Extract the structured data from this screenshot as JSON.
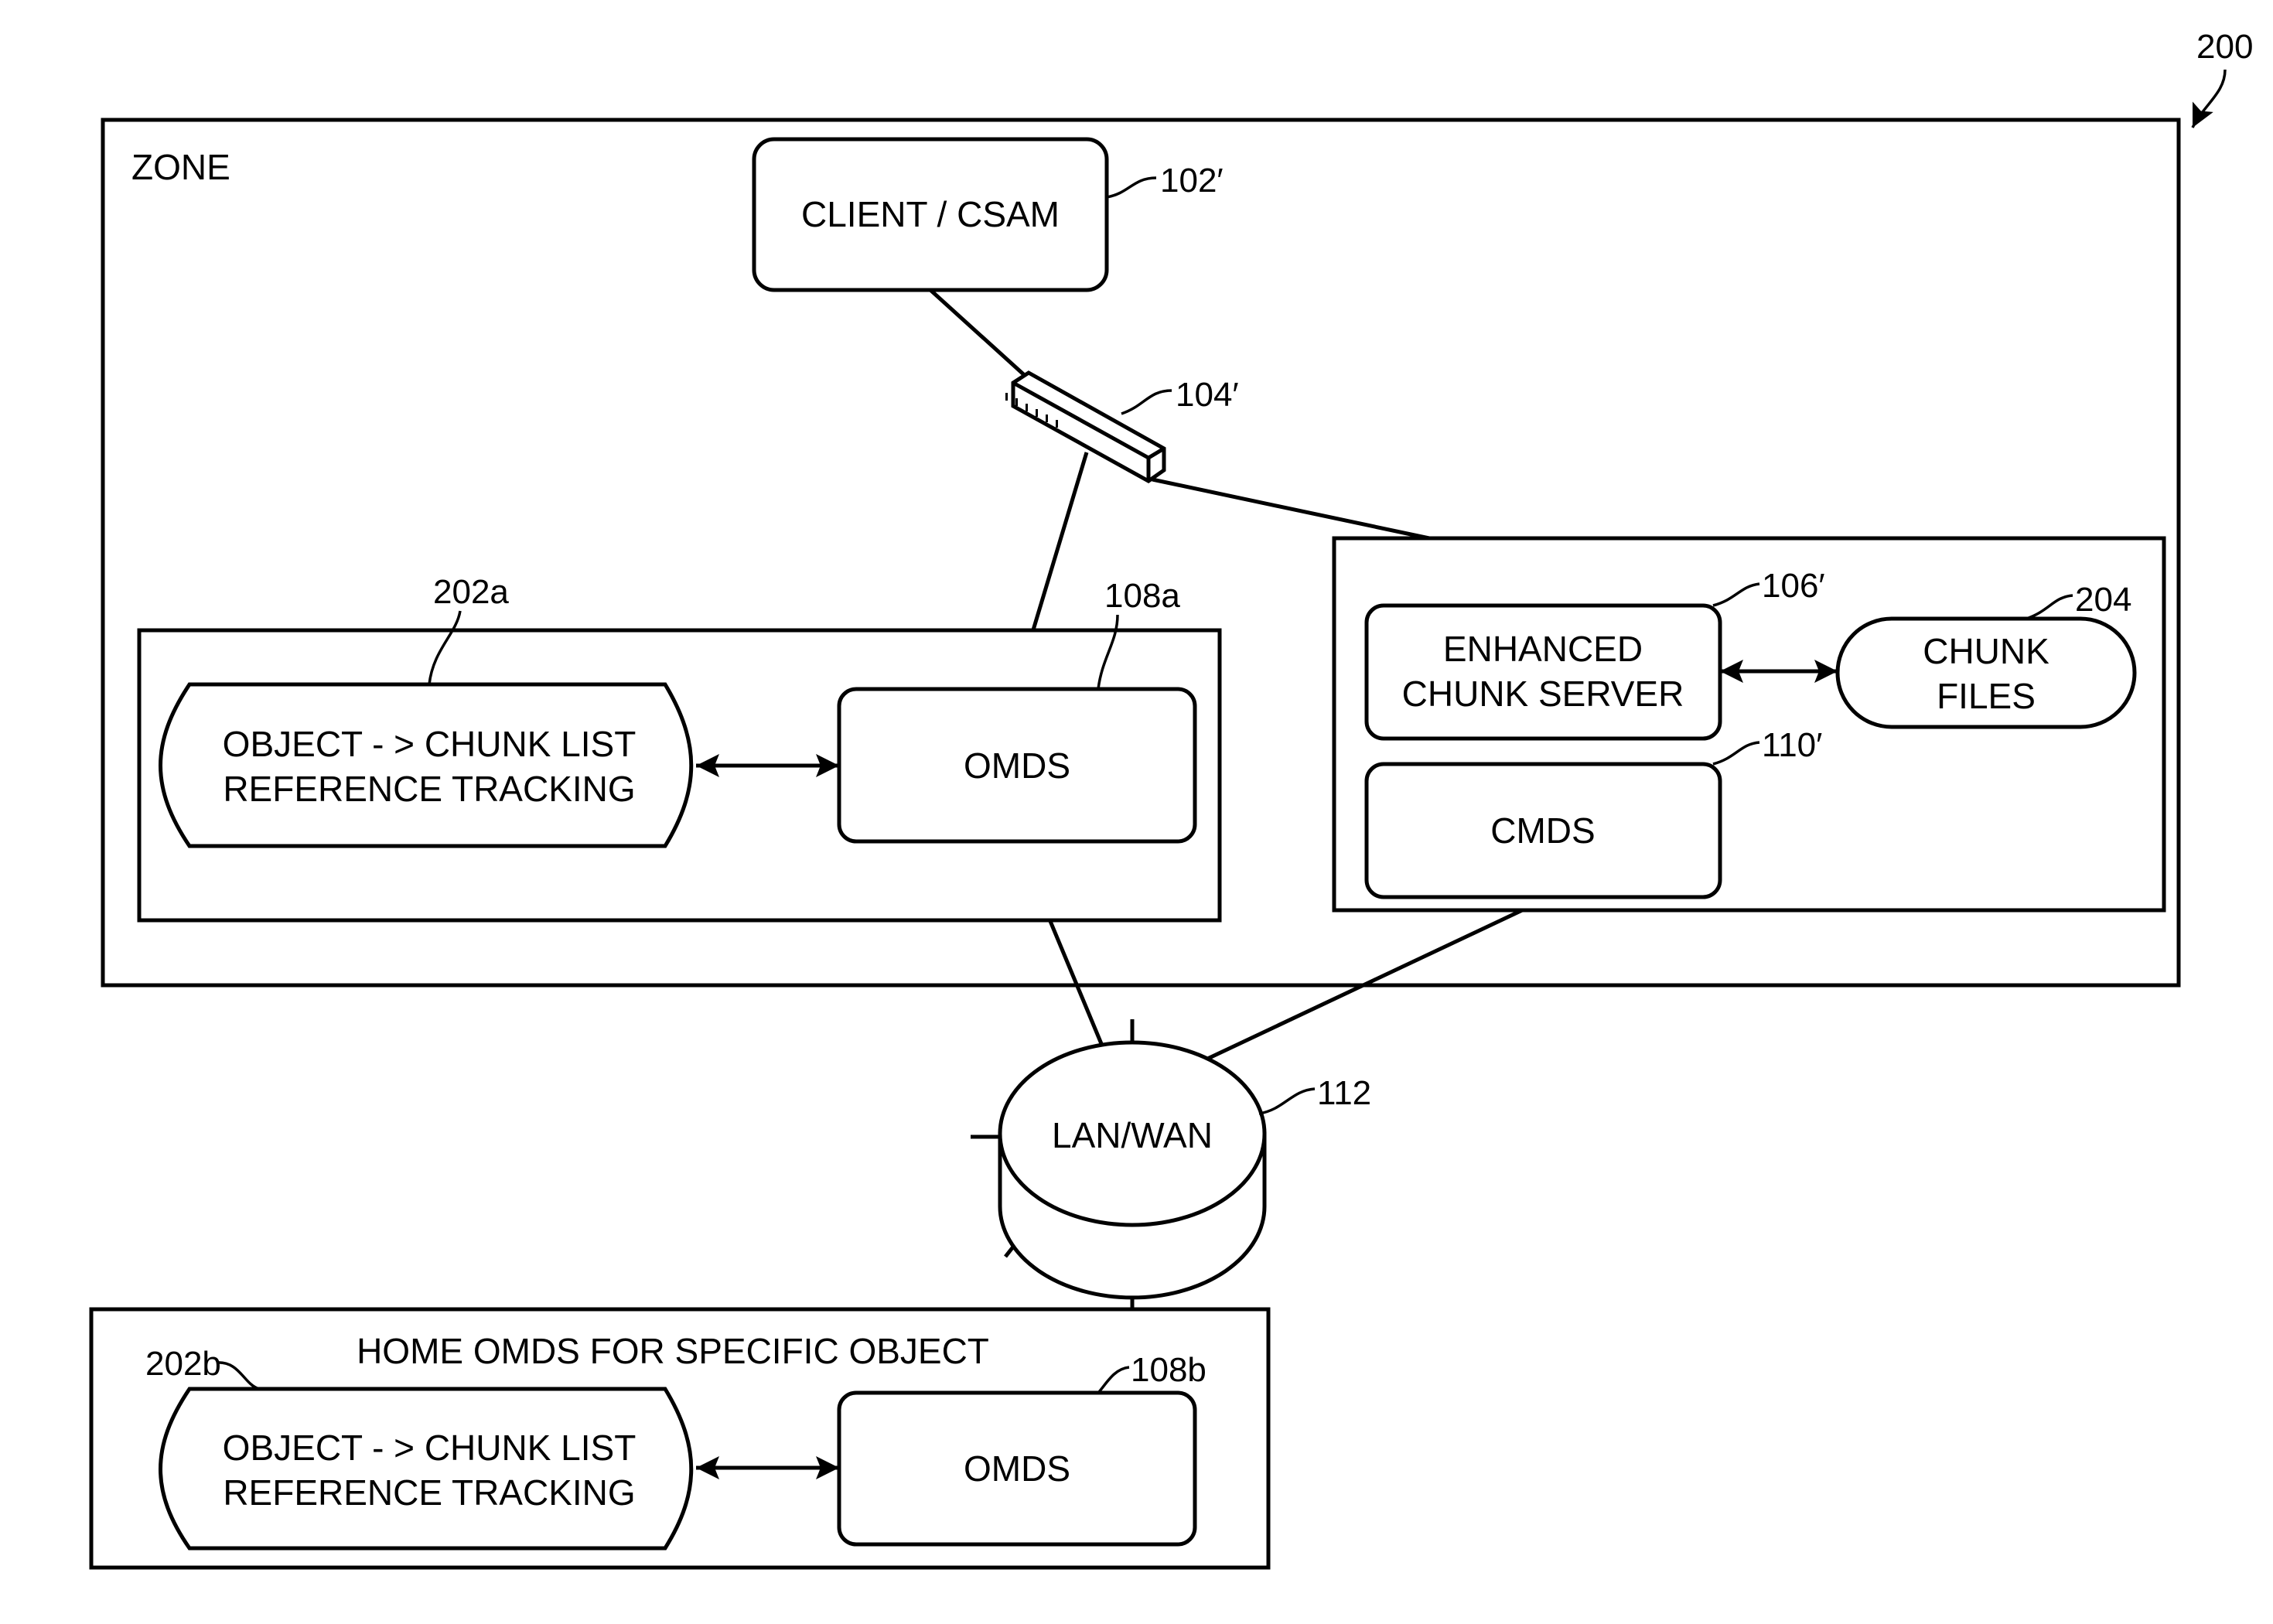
{
  "figure": {
    "reference": "200",
    "zone_label": "ZONE"
  },
  "nodes": {
    "client": {
      "label": "CLIENT / CSAM",
      "ref": "102′"
    },
    "switch": {
      "ref": "104′"
    },
    "tracking_a": {
      "line1": "OBJECT - > CHUNK LIST",
      "line2": "REFERENCE TRACKING",
      "ref": "202a"
    },
    "omds_a": {
      "label": "OMDS",
      "ref": "108a"
    },
    "chunk_server": {
      "line1": "ENHANCED",
      "line2": "CHUNK SERVER",
      "ref": "106′"
    },
    "chunk_files": {
      "line1": "CHUNK",
      "line2": "FILES",
      "ref": "204"
    },
    "cmds": {
      "label": "CMDS",
      "ref": "110′"
    },
    "network": {
      "label": "LAN/WAN",
      "ref": "112"
    },
    "home_group": {
      "title": "HOME OMDS FOR SPECIFIC OBJECT"
    },
    "tracking_b": {
      "line1": "OBJECT - > CHUNK LIST",
      "line2": "REFERENCE TRACKING",
      "ref": "202b"
    },
    "omds_b": {
      "label": "OMDS",
      "ref": "108b"
    }
  }
}
